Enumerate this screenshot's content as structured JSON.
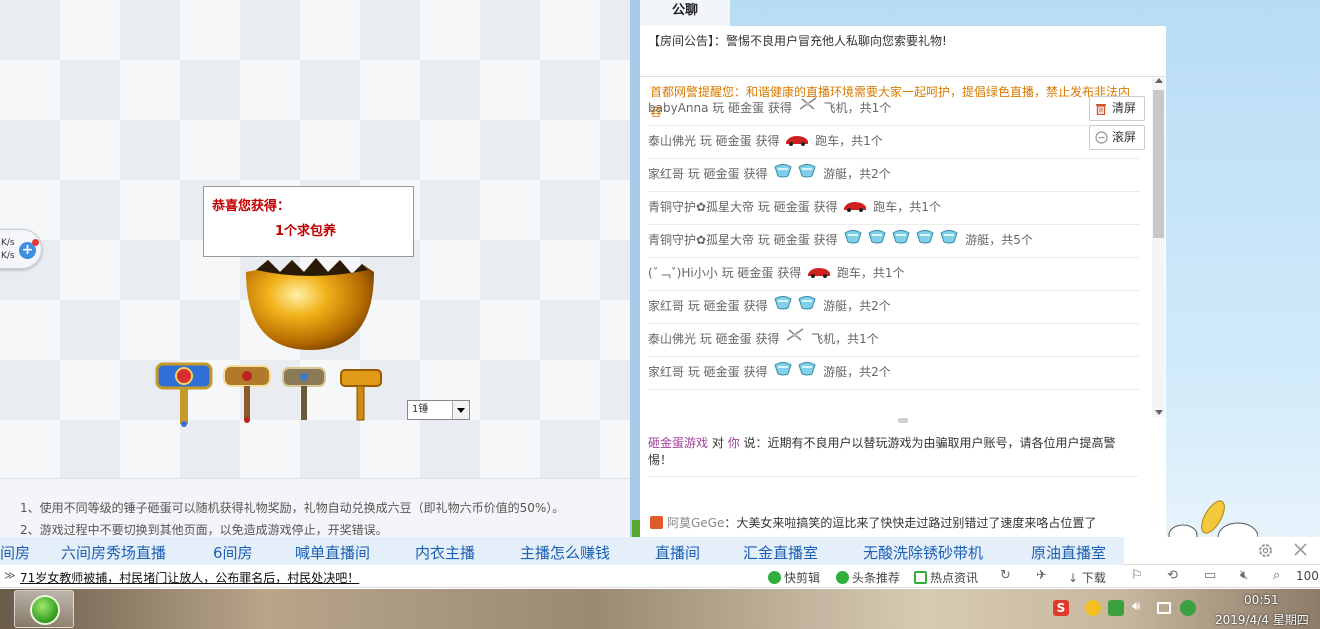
{
  "game": {
    "speed_up": "K/s",
    "speed_down": "K/s",
    "speed_add_label": "+",
    "prize_title": "恭喜您获得：",
    "prize_item": "1个求包养",
    "hammer_select_value": "1锤",
    "rules": [
      "1、使用不同等级的锤子砸蛋可以随机获得礼物奖励，礼物自动兑换成六豆（即礼物六币价值的50%）。",
      "2、游戏过程中不要切换到其他页面，以免造成游戏停止，开奖错误。"
    ]
  },
  "chat": {
    "tab_label": "公聊",
    "announcement": "【房间公告】：警惕不良用户冒充他人私聊向您索要礼物!",
    "notice": "首都网警提醒您：和谐健康的直播环境需要大家一起呵护，提倡绿色直播，禁止发布非法内容",
    "clear_label": "清屏",
    "scroll_label": "滚屏",
    "log": [
      {
        "user": "babyAnna",
        "action": "玩 砸金蛋 获得",
        "gift": "plane",
        "count": 1,
        "gift_name": "飞机",
        "total": "，共1个"
      },
      {
        "user": "泰山佛光",
        "action": "玩 砸金蛋 获得",
        "gift": "car",
        "count": 1,
        "gift_name": "跑车",
        "total": "，共1个"
      },
      {
        "user": "家红哥",
        "action": "玩 砸金蛋 获得",
        "gift": "yacht",
        "count": 2,
        "gift_name": "游艇",
        "total": "，共2个"
      },
      {
        "user": "青铜守护✿孤星大帝",
        "action": "玩 砸金蛋 获得",
        "gift": "car",
        "count": 1,
        "gift_name": "跑车",
        "total": "，共1个"
      },
      {
        "user": "青铜守护✿孤星大帝",
        "action": "玩 砸金蛋 获得",
        "gift": "yacht",
        "count": 5,
        "gift_name": "游艇",
        "total": "，共5个"
      },
      {
        "user": "(ˇ﹁ˇ)Hi小小",
        "action": "玩 砸金蛋 获得",
        "gift": "car",
        "count": 1,
        "gift_name": "跑车",
        "total": "，共1个"
      },
      {
        "user": "家红哥",
        "action": "玩 砸金蛋 获得",
        "gift": "yacht",
        "count": 2,
        "gift_name": "游艇",
        "total": "，共2个"
      },
      {
        "user": "泰山佛光",
        "action": "玩 砸金蛋 获得",
        "gift": "plane",
        "count": 1,
        "gift_name": "飞机",
        "total": "，共1个"
      },
      {
        "user": "家红哥",
        "action": "玩 砸金蛋 获得",
        "gift": "yacht",
        "count": 2,
        "gift_name": "游艇",
        "total": "，共2个"
      }
    ],
    "system_message": {
      "sender": "砸金蛋游戏",
      "to_word": "对",
      "target": "你",
      "say_word": "说：",
      "text": "近期有不良用户以替玩游戏为由骗取用户账号，请各位用户提高警惕！"
    },
    "guest_message": {
      "name": "阿莫GeGe",
      "text": "：大美女来啦搞笑的逗比来了快快走过路过别错过了速度来咯占位置了"
    }
  },
  "link_bar": {
    "links": [
      "间房",
      "六间房秀场直播",
      "6间房",
      "喊单直播间",
      "内衣主播",
      "主播怎么赚钱",
      "直播间",
      "汇金直播室",
      "无酸洗除锈砂带机",
      "原油直播室"
    ]
  },
  "news_bar": {
    "expand_label": "≫",
    "headline": "71岁女教师被捕，村民堵门让放人，公布罪名后，村民处决吧！",
    "items": [
      "快剪辑",
      "头条推荐",
      "热点资讯",
      "下载"
    ],
    "zoom": "100"
  },
  "taskbar": {
    "time": "00:51",
    "date": "2019/4/4 星期四"
  },
  "colors": {
    "notice": "#d87a00",
    "prize_red": "#c00000",
    "link_blue": "#1a5fb4",
    "system_purple": "#a0409c"
  }
}
